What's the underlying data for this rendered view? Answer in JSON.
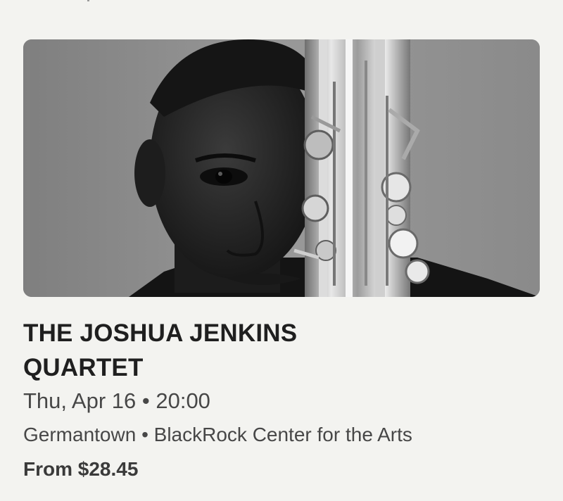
{
  "event": {
    "title": "THE JOSHUA JENKINS QUARTET",
    "datetime": "Thu, Apr 16 • 20:00",
    "venue": "Germantown • BlackRock Center for the Arts",
    "price": "From $28.45",
    "image_subject": "saxophonist-portrait"
  },
  "colors": {
    "background": "#f3f3f0",
    "title": "#1f1f1f",
    "meta_text": "#474747",
    "price_text": "#3a3a3a"
  }
}
